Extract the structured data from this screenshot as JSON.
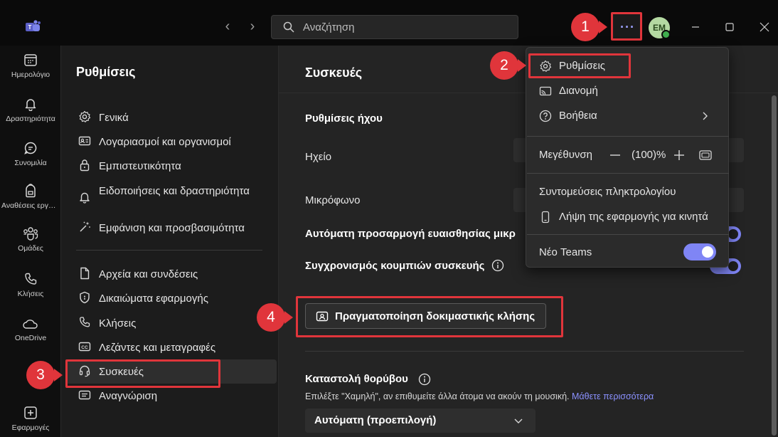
{
  "titlebar": {
    "search_placeholder": "Αναζήτηση",
    "avatar_initials": "EM",
    "more_label": "···"
  },
  "rail": [
    {
      "label": "Ημερολόγιο",
      "icon": "calendar-icon"
    },
    {
      "label": "Δραστηριότητα",
      "icon": "bell-icon"
    },
    {
      "label": "Συνομιλία",
      "icon": "chat-icon"
    },
    {
      "label": "Αναθέσεις εργασιών",
      "icon": "backpack-icon"
    },
    {
      "label": "Ομάδες",
      "icon": "teams-icon"
    },
    {
      "label": "Κλήσεις",
      "icon": "phone-icon"
    },
    {
      "label": "OneDrive",
      "icon": "cloud-icon"
    },
    {
      "label": "Εφαρμογές",
      "icon": "add-app-icon"
    }
  ],
  "settings_nav": {
    "title": "Ρυθμίσεις",
    "items": [
      {
        "label": "Γενικά",
        "icon": "gear-icon"
      },
      {
        "label": "Λογαριασμοί και οργανισμοί",
        "icon": "id-card-icon"
      },
      {
        "label": "Εμπιστευτικότητα",
        "icon": "lock-icon"
      },
      {
        "label": "Ειδοποιήσεις και δραστηριότητα",
        "icon": "bell-icon"
      },
      {
        "label": "Εμφάνιση και προσβασιμότητα",
        "icon": "magic-wand-icon"
      },
      {
        "label": "Αρχεία και συνδέσεις",
        "icon": "file-icon"
      },
      {
        "label": "Δικαιώματα εφαρμογής",
        "icon": "shield-icon"
      },
      {
        "label": "Κλήσεις",
        "icon": "phone-icon"
      },
      {
        "label": "Λεζάντες και μεταγραφές",
        "icon": "captions-icon"
      },
      {
        "label": "Συσκευές",
        "icon": "headset-icon"
      },
      {
        "label": "Αναγνώριση",
        "icon": "feedback-icon"
      }
    ]
  },
  "main": {
    "title": "Συσκευές",
    "audio_heading": "Ρυθμίσεις ήχου",
    "speaker_label": "Ηχείο",
    "mic_label": "Μικρόφωνο",
    "auto_sensitivity_label": "Αυτόματη προσαρμογή ευαισθησίας μικρ",
    "sync_buttons_label": "Συγχρονισμός κουμπιών συσκευής",
    "test_call_label": "Πραγματοποίηση δοκιμαστικής κλήσης",
    "noise_heading": "Καταστολή θορύβου",
    "noise_help": "Επιλέξτε \"Χαμηλή\", αν επιθυμείτε άλλα άτομα να ακούν τη μουσική.",
    "noise_learn_more": "Μάθετε περισσότερα",
    "noise_value": "Αυτόματη (προεπιλογή)"
  },
  "menu": {
    "settings": "Ρυθμίσεις",
    "cast": "Διανομή",
    "help": "Βοήθεια",
    "zoom_label": "Μεγέθυνση",
    "zoom_value": "(100)%",
    "shortcuts": "Συντομεύσεις πληκτρολογίου",
    "mobile_app": "Λήψη της εφαρμογής για κινητά",
    "new_teams": "Νέο Teams"
  },
  "annotations": [
    "1",
    "2",
    "3",
    "4"
  ],
  "colors": {
    "accent": "#7f85f5",
    "annotation": "#e0353b"
  }
}
